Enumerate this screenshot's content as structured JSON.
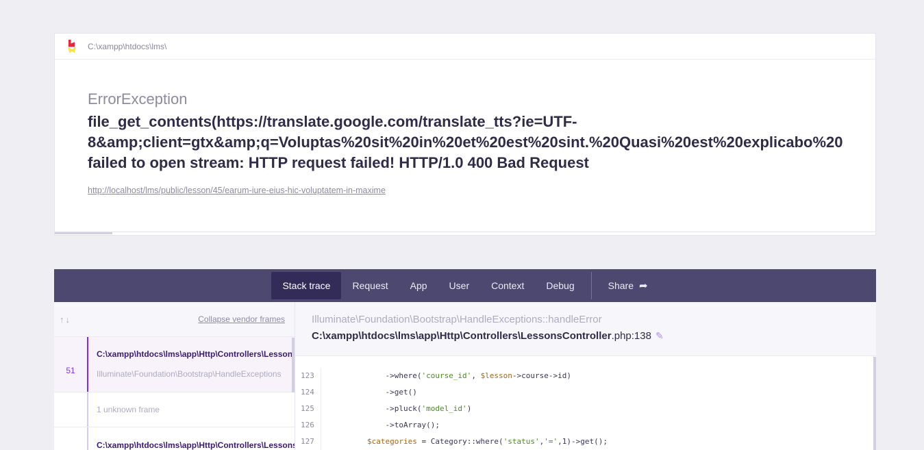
{
  "header": {
    "path": "C:\\xampp\\htdocs\\lms\\"
  },
  "exception": {
    "class": "ErrorException",
    "message_lines": [
      "file_get_contents(https://translate.google.com/translate_tts?ie=UTF-",
      "8&amp;client=gtx&amp;q=Voluptas%20sit%20in%20et%20est%20sint.%20Quasi%20est%20explicabo%20",
      "failed to open stream: HTTP request failed! HTTP/1.0 400 Bad Request"
    ],
    "url": "http://localhost/lms/public/lesson/45/earum-iure-eius-hic-voluptatem-in-maxime",
    "progress_percent": 7
  },
  "tabs": [
    {
      "label": "Stack trace",
      "active": true
    },
    {
      "label": "Request"
    },
    {
      "label": "App"
    },
    {
      "label": "User"
    },
    {
      "label": "Context"
    },
    {
      "label": "Debug"
    }
  ],
  "share_label": "Share",
  "frames_panel": {
    "arrows": "↑↓",
    "collapse_label": "Collapse vendor frames",
    "frames": [
      {
        "file": "C:\\xampp\\htdocs\\lms\\app\\Http\\Controllers\\LessonsController.php",
        "class": "Illuminate\\Foundation\\Bootstrap\\HandleExceptions",
        "number": "51"
      },
      {
        "unknown": "1 unknown frame"
      },
      {
        "file": "C:\\xampp\\htdocs\\lms\\app\\Http\\Controllers\\LessonsController.php"
      }
    ]
  },
  "detail": {
    "class": "Illuminate\\Foundation\\Bootstrap\\HandleExceptions::handleError",
    "file_bold": "C:\\xampp\\htdocs\\lms\\app\\Http\\Controllers\\LessonsController",
    "file_suffix": ".php:138"
  },
  "code": {
    "line_numbers": [
      "123",
      "124",
      "125",
      "126",
      "127"
    ],
    "l123": {
      "a": "            ->where(",
      "s": "'course_id'",
      "b": ", ",
      "v": "$lesson",
      "c": "->course->id)"
    },
    "l124": "            ->get()",
    "l125": {
      "a": "            ->pluck(",
      "s": "'model_id'",
      "c": ")"
    },
    "l126": "            ->toArray();",
    "l127": {
      "v": "        $categories",
      "a": " = Category::where(",
      "s1": "'status'",
      "b": ",",
      "s2": "'='",
      "c": ",1)->get();"
    }
  }
}
